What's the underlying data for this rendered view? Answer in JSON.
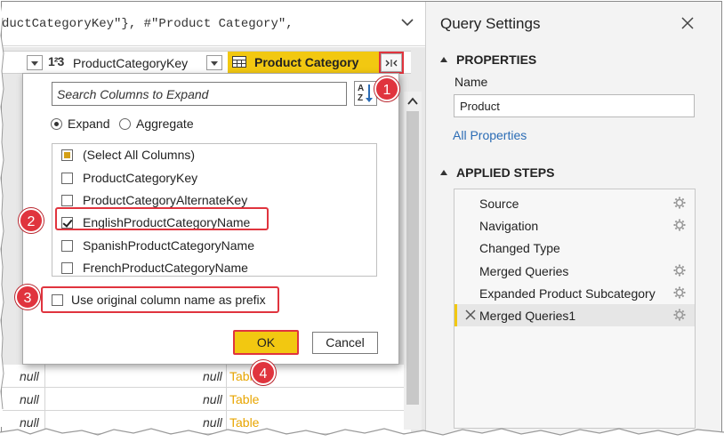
{
  "formula": {
    "part1": "ductCategoryKey\"}, #\"Product Category\","
  },
  "grid": {
    "col_key_type": "1²3",
    "col_key_label": "ProductCategoryKey",
    "col_cat_label": "Product Category",
    "rows": [
      {
        "c1": "null",
        "c2": "null",
        "c3": "Table"
      },
      {
        "c1": "null",
        "c2": "null",
        "c3": "Table"
      },
      {
        "c1": "null",
        "c2": "null",
        "c3": "Table"
      }
    ]
  },
  "dialog": {
    "search_placeholder": "Search Columns to Expand",
    "sort_label": "A Z",
    "radio_expand": "Expand",
    "radio_aggregate": "Aggregate",
    "columns": [
      {
        "label": "(Select All Columns)",
        "state": "partial"
      },
      {
        "label": "ProductCategoryKey",
        "state": "unchecked"
      },
      {
        "label": "ProductCategoryAlternateKey",
        "state": "unchecked"
      },
      {
        "label": "EnglishProductCategoryName",
        "state": "checked"
      },
      {
        "label": "SpanishProductCategoryName",
        "state": "unchecked"
      },
      {
        "label": "FrenchProductCategoryName",
        "state": "unchecked"
      }
    ],
    "prefix_label": "Use original column name as prefix",
    "ok_label": "OK",
    "cancel_label": "Cancel"
  },
  "markers": [
    "1",
    "2",
    "3",
    "4"
  ],
  "query_settings": {
    "title": "Query Settings",
    "properties_head": "PROPERTIES",
    "name_label": "Name",
    "name_value": "Product",
    "all_properties": "All Properties",
    "steps_head": "APPLIED STEPS",
    "steps": [
      {
        "label": "Source",
        "gear": true
      },
      {
        "label": "Navigation",
        "gear": true
      },
      {
        "label": "Changed Type",
        "gear": false
      },
      {
        "label": "Merged Queries",
        "gear": true
      },
      {
        "label": "Expanded Product Subcategory",
        "gear": true
      },
      {
        "label": "Merged Queries1",
        "gear": true,
        "selected": true
      }
    ]
  },
  "colors": {
    "accent_yellow": "#f2c811",
    "callout_red": "#e0343e",
    "link_blue": "#2b6cb5"
  }
}
